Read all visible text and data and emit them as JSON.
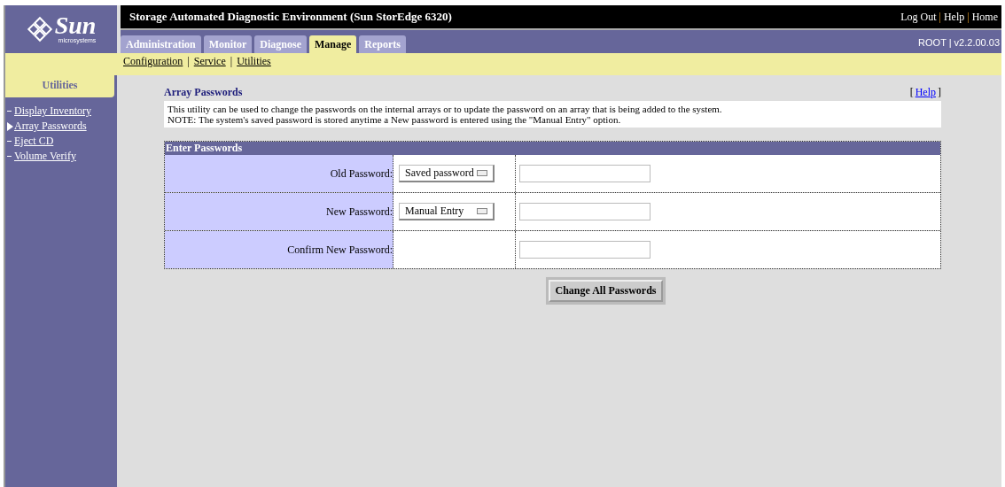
{
  "header": {
    "title": "Storage Automated Diagnostic Environment (Sun StorEdge 6320)",
    "links": [
      "Log Out",
      "Help",
      "Home"
    ],
    "link_separator": "|",
    "user_version": "ROOT | v2.2.00.03"
  },
  "logo": {
    "name": "Sun",
    "subtitle": "microsystems"
  },
  "tabs": [
    {
      "label": "Administration",
      "selected": false
    },
    {
      "label": "Monitor",
      "selected": false
    },
    {
      "label": "Diagnose",
      "selected": false
    },
    {
      "label": "Manage",
      "selected": true
    },
    {
      "label": "Reports",
      "selected": false
    }
  ],
  "subnav": [
    "Configuration",
    "Service",
    "Utilities"
  ],
  "subnav_separator": "|",
  "sidebar": {
    "title": "Utilities",
    "items": [
      {
        "label": "Display Inventory",
        "selected": false
      },
      {
        "label": "Array Passwords",
        "selected": true
      },
      {
        "label": "Eject CD",
        "selected": false
      },
      {
        "label": "Volume Verify",
        "selected": false
      }
    ]
  },
  "page": {
    "title": "Array Passwords",
    "help": "Help",
    "help_brackets": [
      "[",
      "]"
    ],
    "description": [
      "This utility can be used to change the passwords on the internal arrays or to update the password on an array that is being added to the system.",
      "NOTE: The system's saved password is stored anytime a New password is entered using the \"Manual Entry\" option."
    ]
  },
  "form": {
    "title": "Enter Passwords",
    "rows": [
      {
        "label": "Old Password:",
        "select": "Saved password"
      },
      {
        "label": "New Password:",
        "select": "Manual Entry"
      },
      {
        "label": "Confirm New Password:"
      }
    ],
    "button": "Change All Passwords"
  }
}
